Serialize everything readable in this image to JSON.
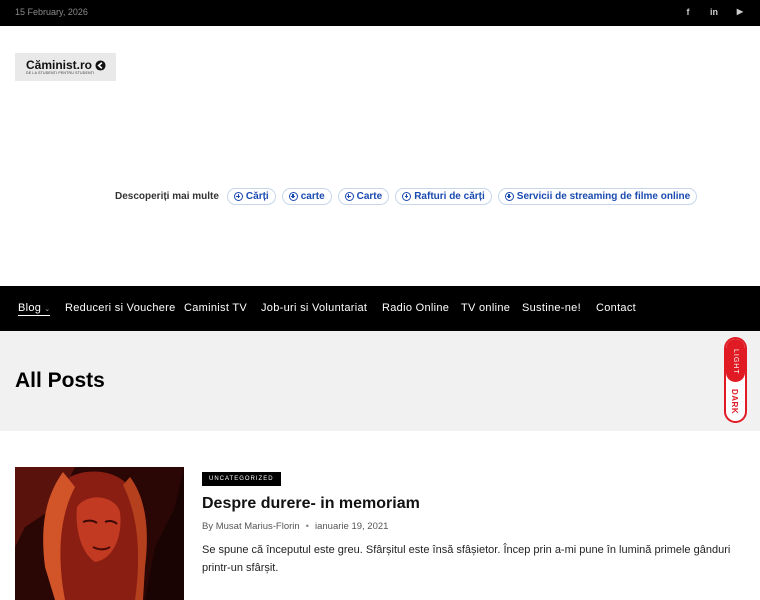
{
  "topbar": {
    "date": "15 February, 2026",
    "social": [
      {
        "icon": "facebook-icon",
        "glyph": "f"
      },
      {
        "icon": "linkedin-icon",
        "glyph": "in"
      },
      {
        "icon": "youtube-icon",
        "glyph": "▶"
      }
    ]
  },
  "logo": {
    "name": "Căminist.ro",
    "tagline": "DE LA STUDENȚI PENTRU STUDENȚI"
  },
  "discover": {
    "label": "Descoperiți mai multe",
    "chips": [
      "Cărți",
      "carte",
      "Carte",
      "Rafturi de cărți",
      "Servicii de streaming de filme online"
    ]
  },
  "nav": {
    "items": [
      "Blog",
      "Reduceri si Vouchere",
      "Caminist TV",
      "Job-uri si Voluntariat",
      "Radio Online",
      "TV online",
      "Sustine-ne!",
      "Contact"
    ],
    "chevron": "⌄"
  },
  "page": {
    "title": "All Posts"
  },
  "theme_toggle": {
    "light": "LIGHT",
    "dark": "DARK",
    "accent": "#e01b24"
  },
  "post": {
    "category": "UNCATEGORIZED",
    "title": "Despre durere- in memoriam",
    "author": "By Musat Marius-Florin",
    "separator": "•",
    "date": "ianuarie 19, 2021",
    "excerpt": "Se spune că începutul este greu. Sfârșitul este însă sfâșietor. Încep prin a-mi pune în lumină primele gânduri printr-un sfârșit."
  }
}
